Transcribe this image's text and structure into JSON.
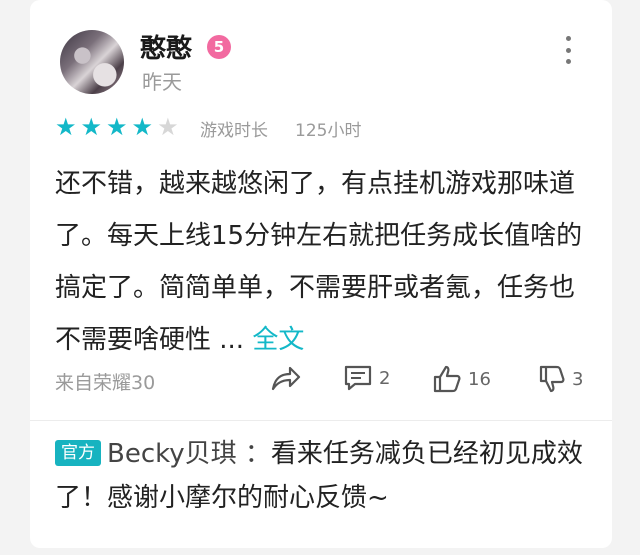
{
  "user": {
    "name": "憨憨",
    "level": "5",
    "time": "昨天"
  },
  "rating": {
    "stars_filled": 4,
    "stars_total": 5,
    "playtime_label": "游戏时长",
    "playtime_value": "125小时"
  },
  "review": {
    "text": "还不错，越来越悠闲了，有点挂机游戏那味道了。每天上线15分钟左右就把任务成长值啥的搞定了。简简单单，不需要肝或者氪，任务也不需要啥硬性 ...",
    "more_label": "全文"
  },
  "footer": {
    "device": "来自荣耀30",
    "share_icon": "share-icon",
    "comment_count": "2",
    "like_count": "16",
    "dislike_count": "3"
  },
  "reply": {
    "tag": "官方",
    "author": "Becky贝琪 ：",
    "text": "看来任务减负已经初见成效了！感谢小摩尔的耐心反馈~"
  },
  "colors": {
    "accent": "#13b8c8",
    "level_badge": "#f26aa0"
  }
}
